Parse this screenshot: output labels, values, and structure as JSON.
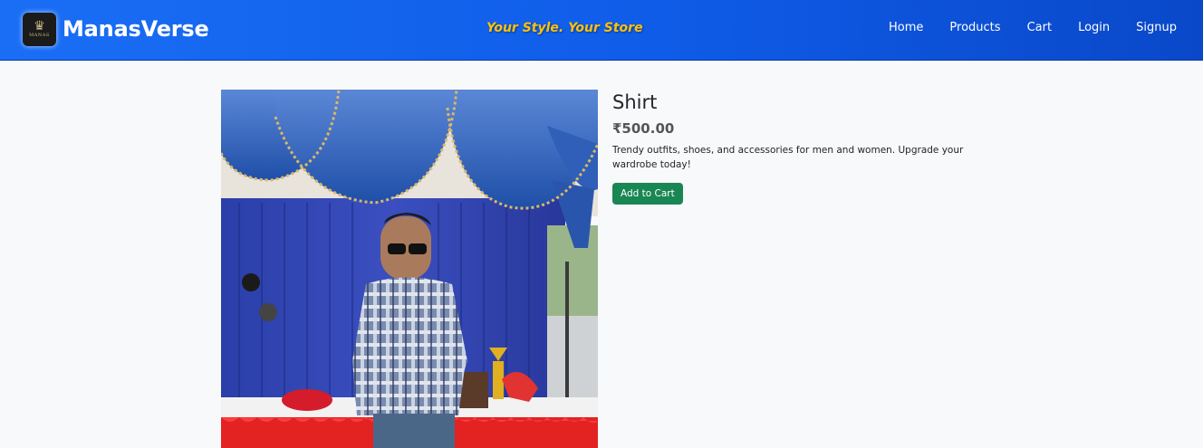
{
  "header": {
    "brand_name": "ManasVerse",
    "logo_text": "MANAS",
    "tagline": "Your Style. Your Store",
    "nav": [
      {
        "label": "Home"
      },
      {
        "label": "Products"
      },
      {
        "label": "Cart"
      },
      {
        "label": "Login"
      },
      {
        "label": "Signup"
      }
    ]
  },
  "product": {
    "image_alt": "Shirt",
    "title": "Shirt",
    "price": "₹500.00",
    "description": "Trendy outfits, shoes, and accessories for men and women. Upgrade your wardrobe today!",
    "add_to_cart_label": "Add to Cart"
  },
  "colors": {
    "navbar": "#0f5ce8",
    "tagline": "#ffc107",
    "button": "#198754"
  }
}
